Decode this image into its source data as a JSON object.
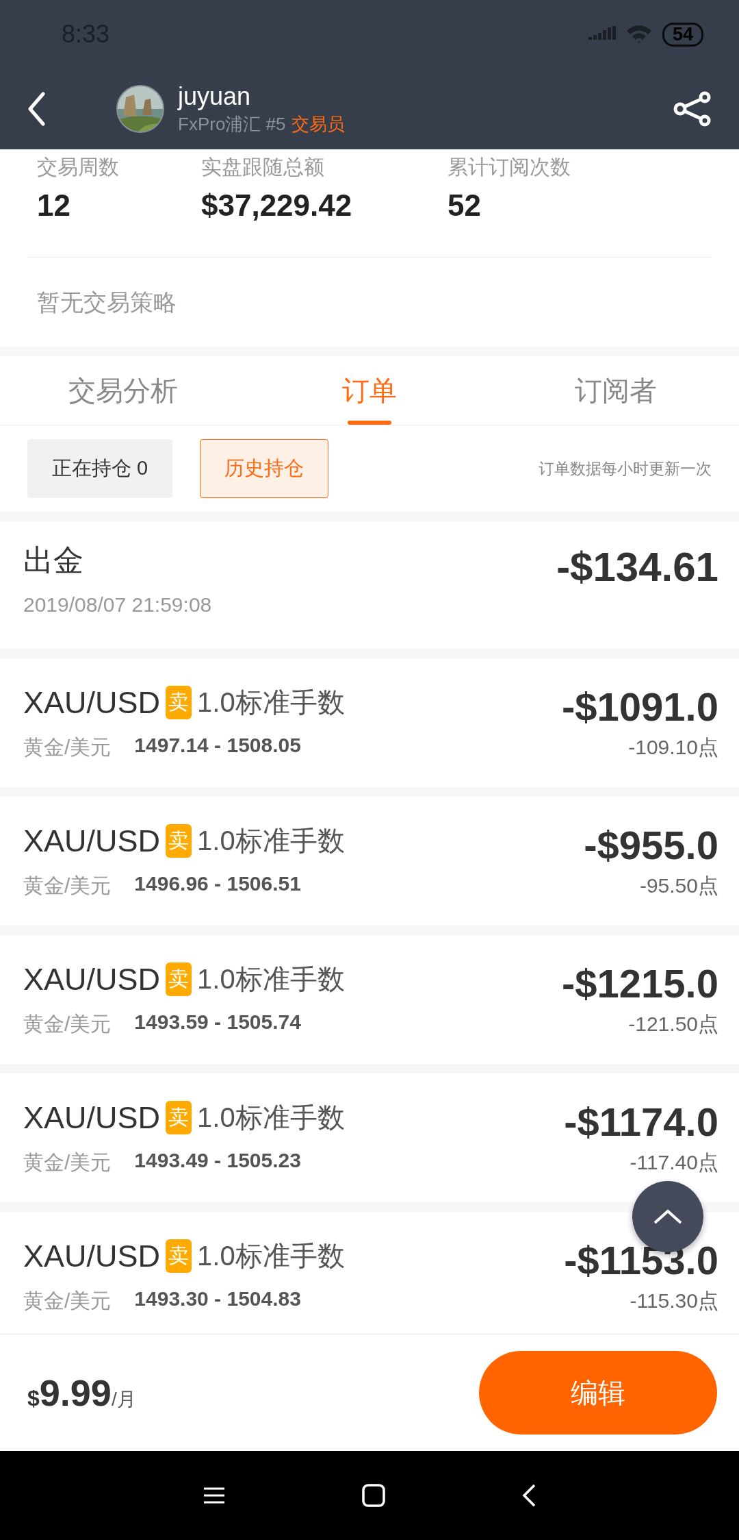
{
  "status_bar": {
    "time": "8:33",
    "battery": "54"
  },
  "header": {
    "name": "juyuan",
    "broker": "FxPro浦汇 #5",
    "role": "交易员"
  },
  "stats": [
    {
      "label": "交易周数",
      "value": "12"
    },
    {
      "label": "实盘跟随总额",
      "value": "$37,229.42"
    },
    {
      "label": "累计订阅次数",
      "value": "52"
    }
  ],
  "strategy": "暂无交易策略",
  "tabs": [
    {
      "label": "交易分析",
      "selected": false
    },
    {
      "label": "订单",
      "selected": true
    },
    {
      "label": "订阅者",
      "selected": false
    }
  ],
  "filters": [
    {
      "label": "正在持仓 0",
      "selected": false
    },
    {
      "label": "历史持仓",
      "selected": true
    }
  ],
  "filter_note": "订单数据每小时更新一次",
  "records": [
    {
      "kind": "withdrawal",
      "title": "出金",
      "time": "2019/08/07 21:59:08",
      "amount": "-$134.61"
    },
    {
      "kind": "order",
      "symbol": "XAU/USD",
      "side": "卖",
      "lots": "1.0标准手数",
      "name": "黄金/美元",
      "prices": "1497.14 - 1508.05",
      "amount": "-$1091.0",
      "points": "-109.10点"
    },
    {
      "kind": "order",
      "symbol": "XAU/USD",
      "side": "卖",
      "lots": "1.0标准手数",
      "name": "黄金/美元",
      "prices": "1496.96 - 1506.51",
      "amount": "-$955.0",
      "points": "-95.50点"
    },
    {
      "kind": "order",
      "symbol": "XAU/USD",
      "side": "卖",
      "lots": "1.0标准手数",
      "name": "黄金/美元",
      "prices": "1493.59 - 1505.74",
      "amount": "-$1215.0",
      "points": "-121.50点"
    },
    {
      "kind": "order",
      "symbol": "XAU/USD",
      "side": "卖",
      "lots": "1.0标准手数",
      "name": "黄金/美元",
      "prices": "1493.49 - 1505.23",
      "amount": "-$1174.0",
      "points": "-117.40点"
    },
    {
      "kind": "order",
      "symbol": "XAU/USD",
      "side": "卖",
      "lots": "1.0标准手数",
      "name": "黄金/美元",
      "prices": "1493.30 - 1504.83",
      "amount": "-$1153.0",
      "points": "-115.30点"
    }
  ],
  "footer": {
    "currency": "$",
    "price": "9.99",
    "period": "/月",
    "button": "编辑"
  }
}
